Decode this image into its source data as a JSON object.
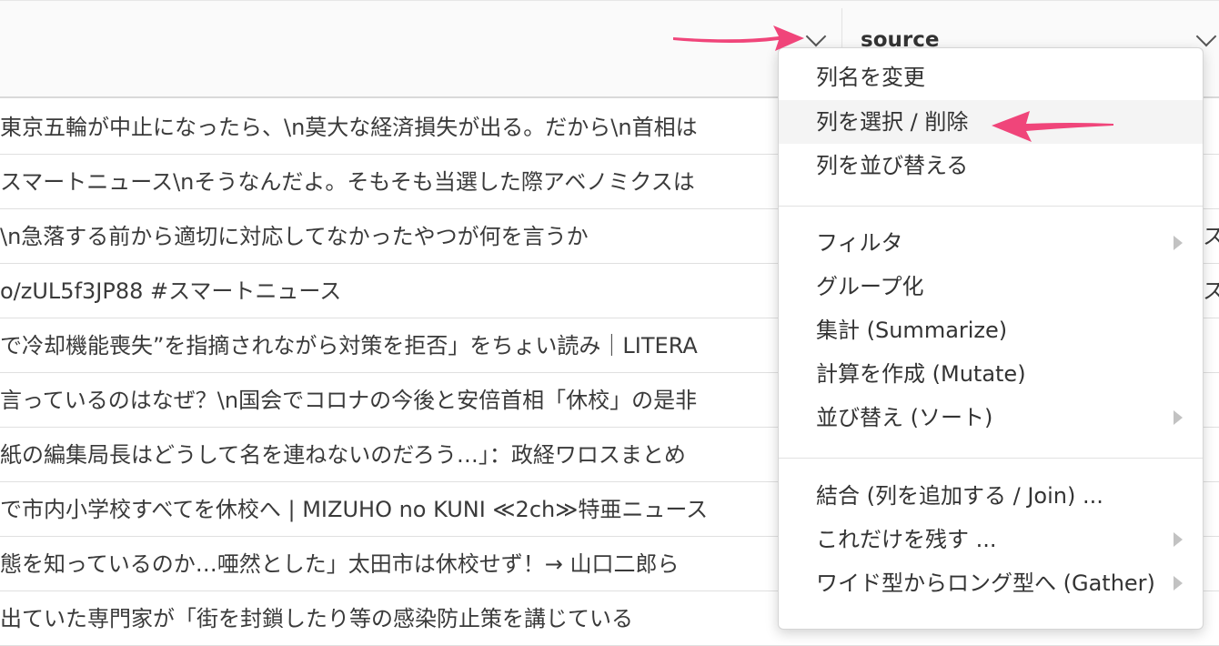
{
  "header": {
    "right_column_name": "source"
  },
  "rows": [
    {
      "text": "東京五輪が中止になったら、\\n莫大な経済損失が出る。だから\\n首相は",
      "right": ""
    },
    {
      "text": "スマートニュース\\nそうなんだよ。そもそも当選した際アベノミクスは",
      "right": ""
    },
    {
      "text": "\\n急落する前から適切に対応してなかったやつが何を言うか",
      "right": "ス"
    },
    {
      "text": "o/zUL5f3JP88 #スマートニュース",
      "right": "ス"
    },
    {
      "text": "で冷却機能喪失”を指摘されながら対策を拒否」をちょい読み｜LITERA",
      "right": ""
    },
    {
      "text": "言っているのはなぜ？\\n国会でコロナの今後と安倍首相「休校」の是非",
      "right": ""
    },
    {
      "text": "紙の編集局長はどうして名を連ねないのだろう…」：政経ワロスまとめ",
      "right": ""
    },
    {
      "text": "で市内小学校すべてを休校へ | MIZUHO no KUNI ≪2ch≫特亜ニュース",
      "right": ""
    },
    {
      "text": "態を知っているのか…唖然とした」太田市は休校せず！→ 山口二郎ら",
      "right": ""
    },
    {
      "text": "出ていた専門家が「街を封鎖したり等の感染防止策を講じている",
      "right": ""
    }
  ],
  "menu": {
    "rename": "列名を変更",
    "select_delete": "列を選択 / 削除",
    "reorder": "列を並び替える",
    "filter": "フィルタ",
    "group": "グループ化",
    "summarize": "集計 (Summarize)",
    "mutate": "計算を作成 (Mutate)",
    "sort": "並び替え (ソート)",
    "join": "結合 (列を追加する / Join) ...",
    "keep_only": "これだけを残す ...",
    "gather": "ワイド型からロング型へ (Gather)"
  },
  "colors": {
    "annotation_arrow": "#f0457a"
  },
  "icons": {
    "column_dropdown": "chevron-down-icon",
    "submenu": "caret-right-icon"
  }
}
